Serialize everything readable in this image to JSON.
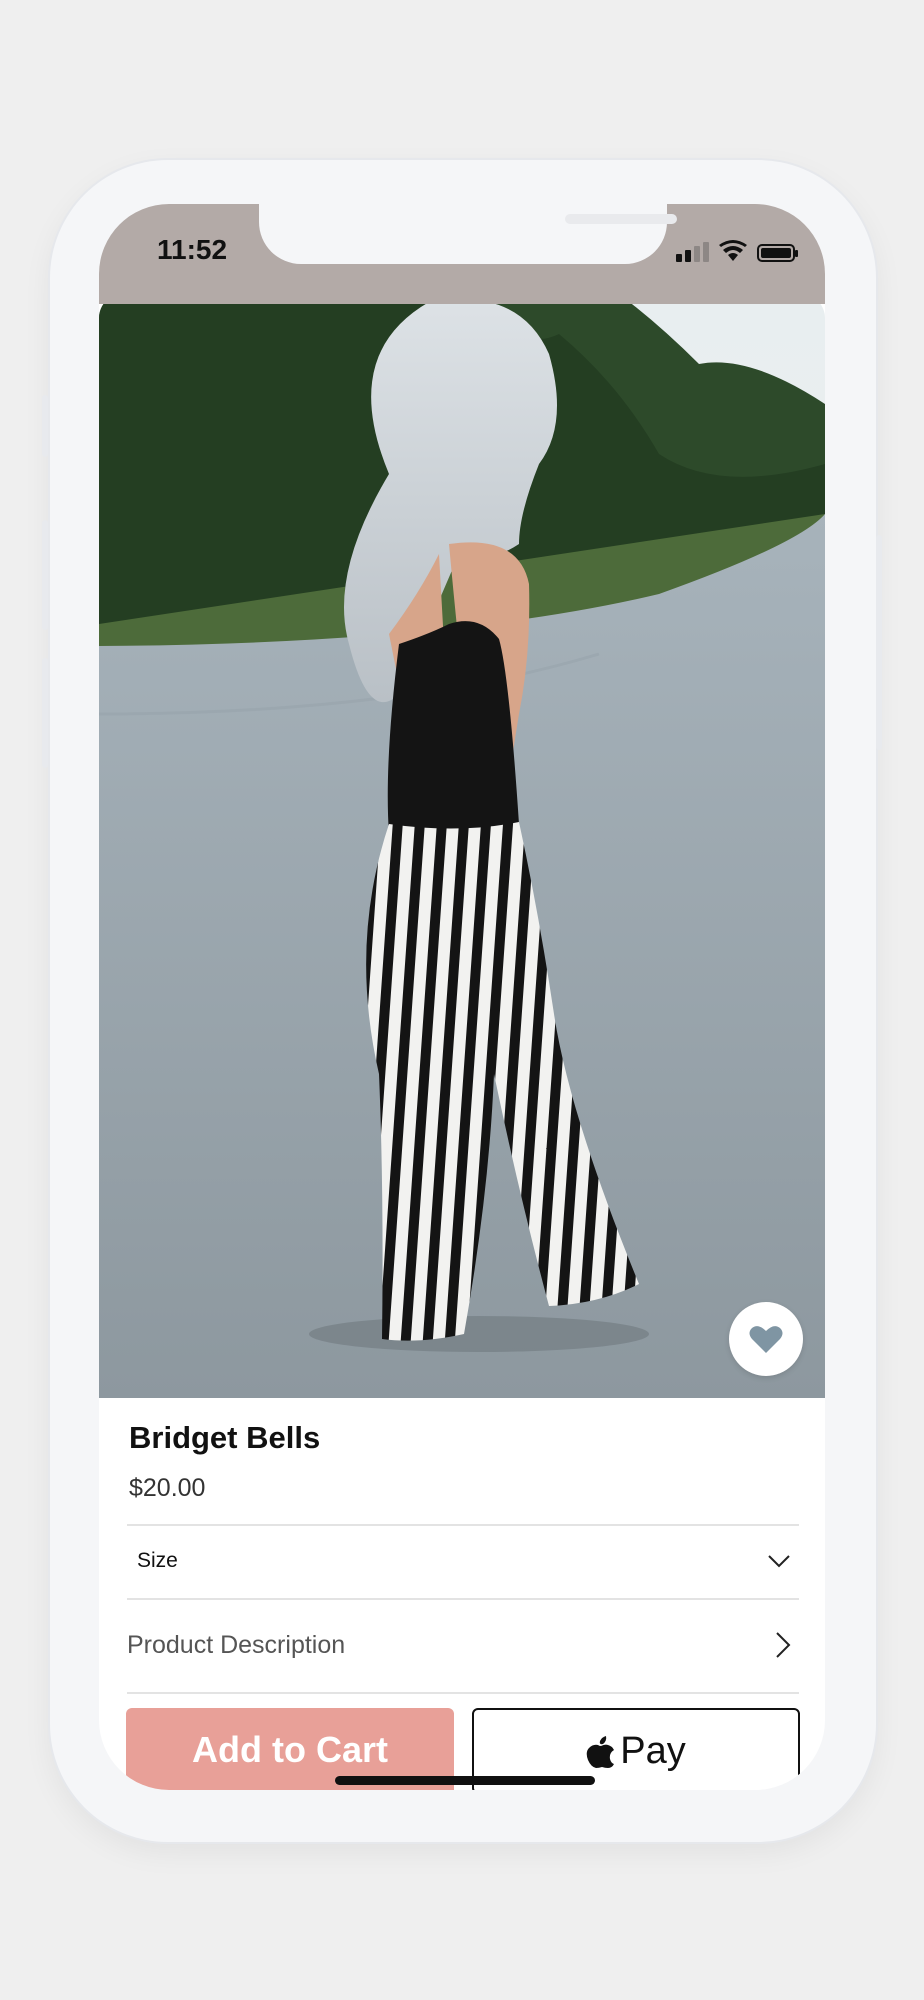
{
  "status_bar": {
    "time": "11:52",
    "icons": [
      "cellular-signal-icon",
      "wifi-icon",
      "battery-icon"
    ]
  },
  "product": {
    "image_alt": "Bridget Bells",
    "title": "Bridget Bells",
    "price": "$20.00",
    "favorite_icon": "heart-icon"
  },
  "options": {
    "size_label": "Size",
    "size_icon": "chevron-down-icon",
    "description_label": "Product Description",
    "description_icon": "chevron-right-icon"
  },
  "actions": {
    "add_to_cart_label": "Add to Cart",
    "apple_pay_label": "Pay",
    "apple_pay_icon": "apple-logo-icon"
  },
  "colors": {
    "status_bar_bg": "#b3aaa7",
    "add_to_cart_bg": "#e8a098",
    "heart": "#7f95a3"
  }
}
